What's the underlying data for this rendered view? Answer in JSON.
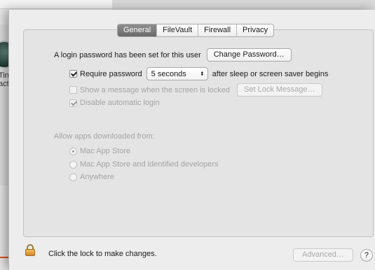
{
  "background": {
    "fragment_text": "Tin\nact"
  },
  "tabs": [
    {
      "label": "General",
      "selected": true
    },
    {
      "label": "FileVault",
      "selected": false
    },
    {
      "label": "Firewall",
      "selected": false
    },
    {
      "label": "Privacy",
      "selected": false
    }
  ],
  "general": {
    "login_text": "A login password has been set for this user",
    "change_password_button": "Change Password…",
    "require_password_label": "Require password",
    "require_password_checked": true,
    "require_password_value": "5 seconds",
    "after_sleep_text": "after sleep or screen saver begins",
    "show_message_label": "Show a message when the screen is locked",
    "show_message_checked": false,
    "set_lock_message_button": "Set Lock Message…",
    "disable_login_label": "Disable automatic login",
    "disable_login_checked": true
  },
  "apps": {
    "heading": "Allow apps downloaded from:",
    "options": [
      {
        "label": "Mac App Store",
        "selected": true
      },
      {
        "label": "Mac App Store and identified developers",
        "selected": false
      },
      {
        "label": "Anywhere",
        "selected": false
      }
    ]
  },
  "footer": {
    "lock_text": "Click the lock to make changes.",
    "advanced_button": "Advanced…",
    "help_label": "?"
  },
  "icons": {
    "lock": "lock-icon",
    "help": "help-icon",
    "popup_arrows": "up-down-arrows-icon"
  },
  "colors": {
    "selected_tab": "#7b7b7b",
    "lock_gold": "#e3a548",
    "annotation_red": "#e8541f"
  }
}
